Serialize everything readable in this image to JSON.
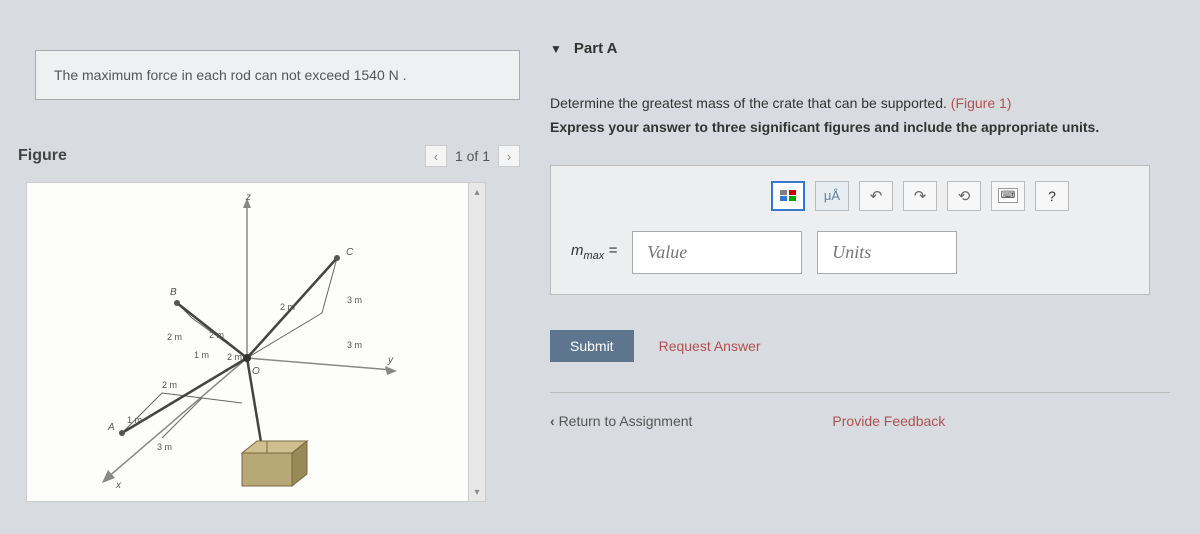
{
  "problem": {
    "statement": "The maximum force in each rod can not exceed 1540 N ."
  },
  "figure": {
    "title": "Figure",
    "pager": "1 of 1"
  },
  "part": {
    "title": "Part A",
    "line1_prefix": "Determine the greatest mass of the crate that can be supported. ",
    "figure_link": "(Figure 1)",
    "line2": "Express your answer to three significant figures and include the appropriate units."
  },
  "answer": {
    "ua_label": "μÅ",
    "help_label": "?",
    "variable_html": "m",
    "variable_sub": "max",
    "equals": " =",
    "value_placeholder": "Value",
    "units_placeholder": "Units",
    "submit": "Submit",
    "request": "Request Answer"
  },
  "footer": {
    "return": "Return to Assignment",
    "feedback": "Provide Feedback"
  },
  "diagram_labels": {
    "l1": "3 m",
    "l2": "2 m",
    "l3": "2 m",
    "l4": "1 m",
    "l5": "2 m",
    "l6": "2 m",
    "l7": "3 m",
    "l8": "1 m",
    "l9": "3 m",
    "pA": "A",
    "pB": "B",
    "pC": "C",
    "pO": "O",
    "axX": "x",
    "axY": "y",
    "axZ": "z"
  }
}
